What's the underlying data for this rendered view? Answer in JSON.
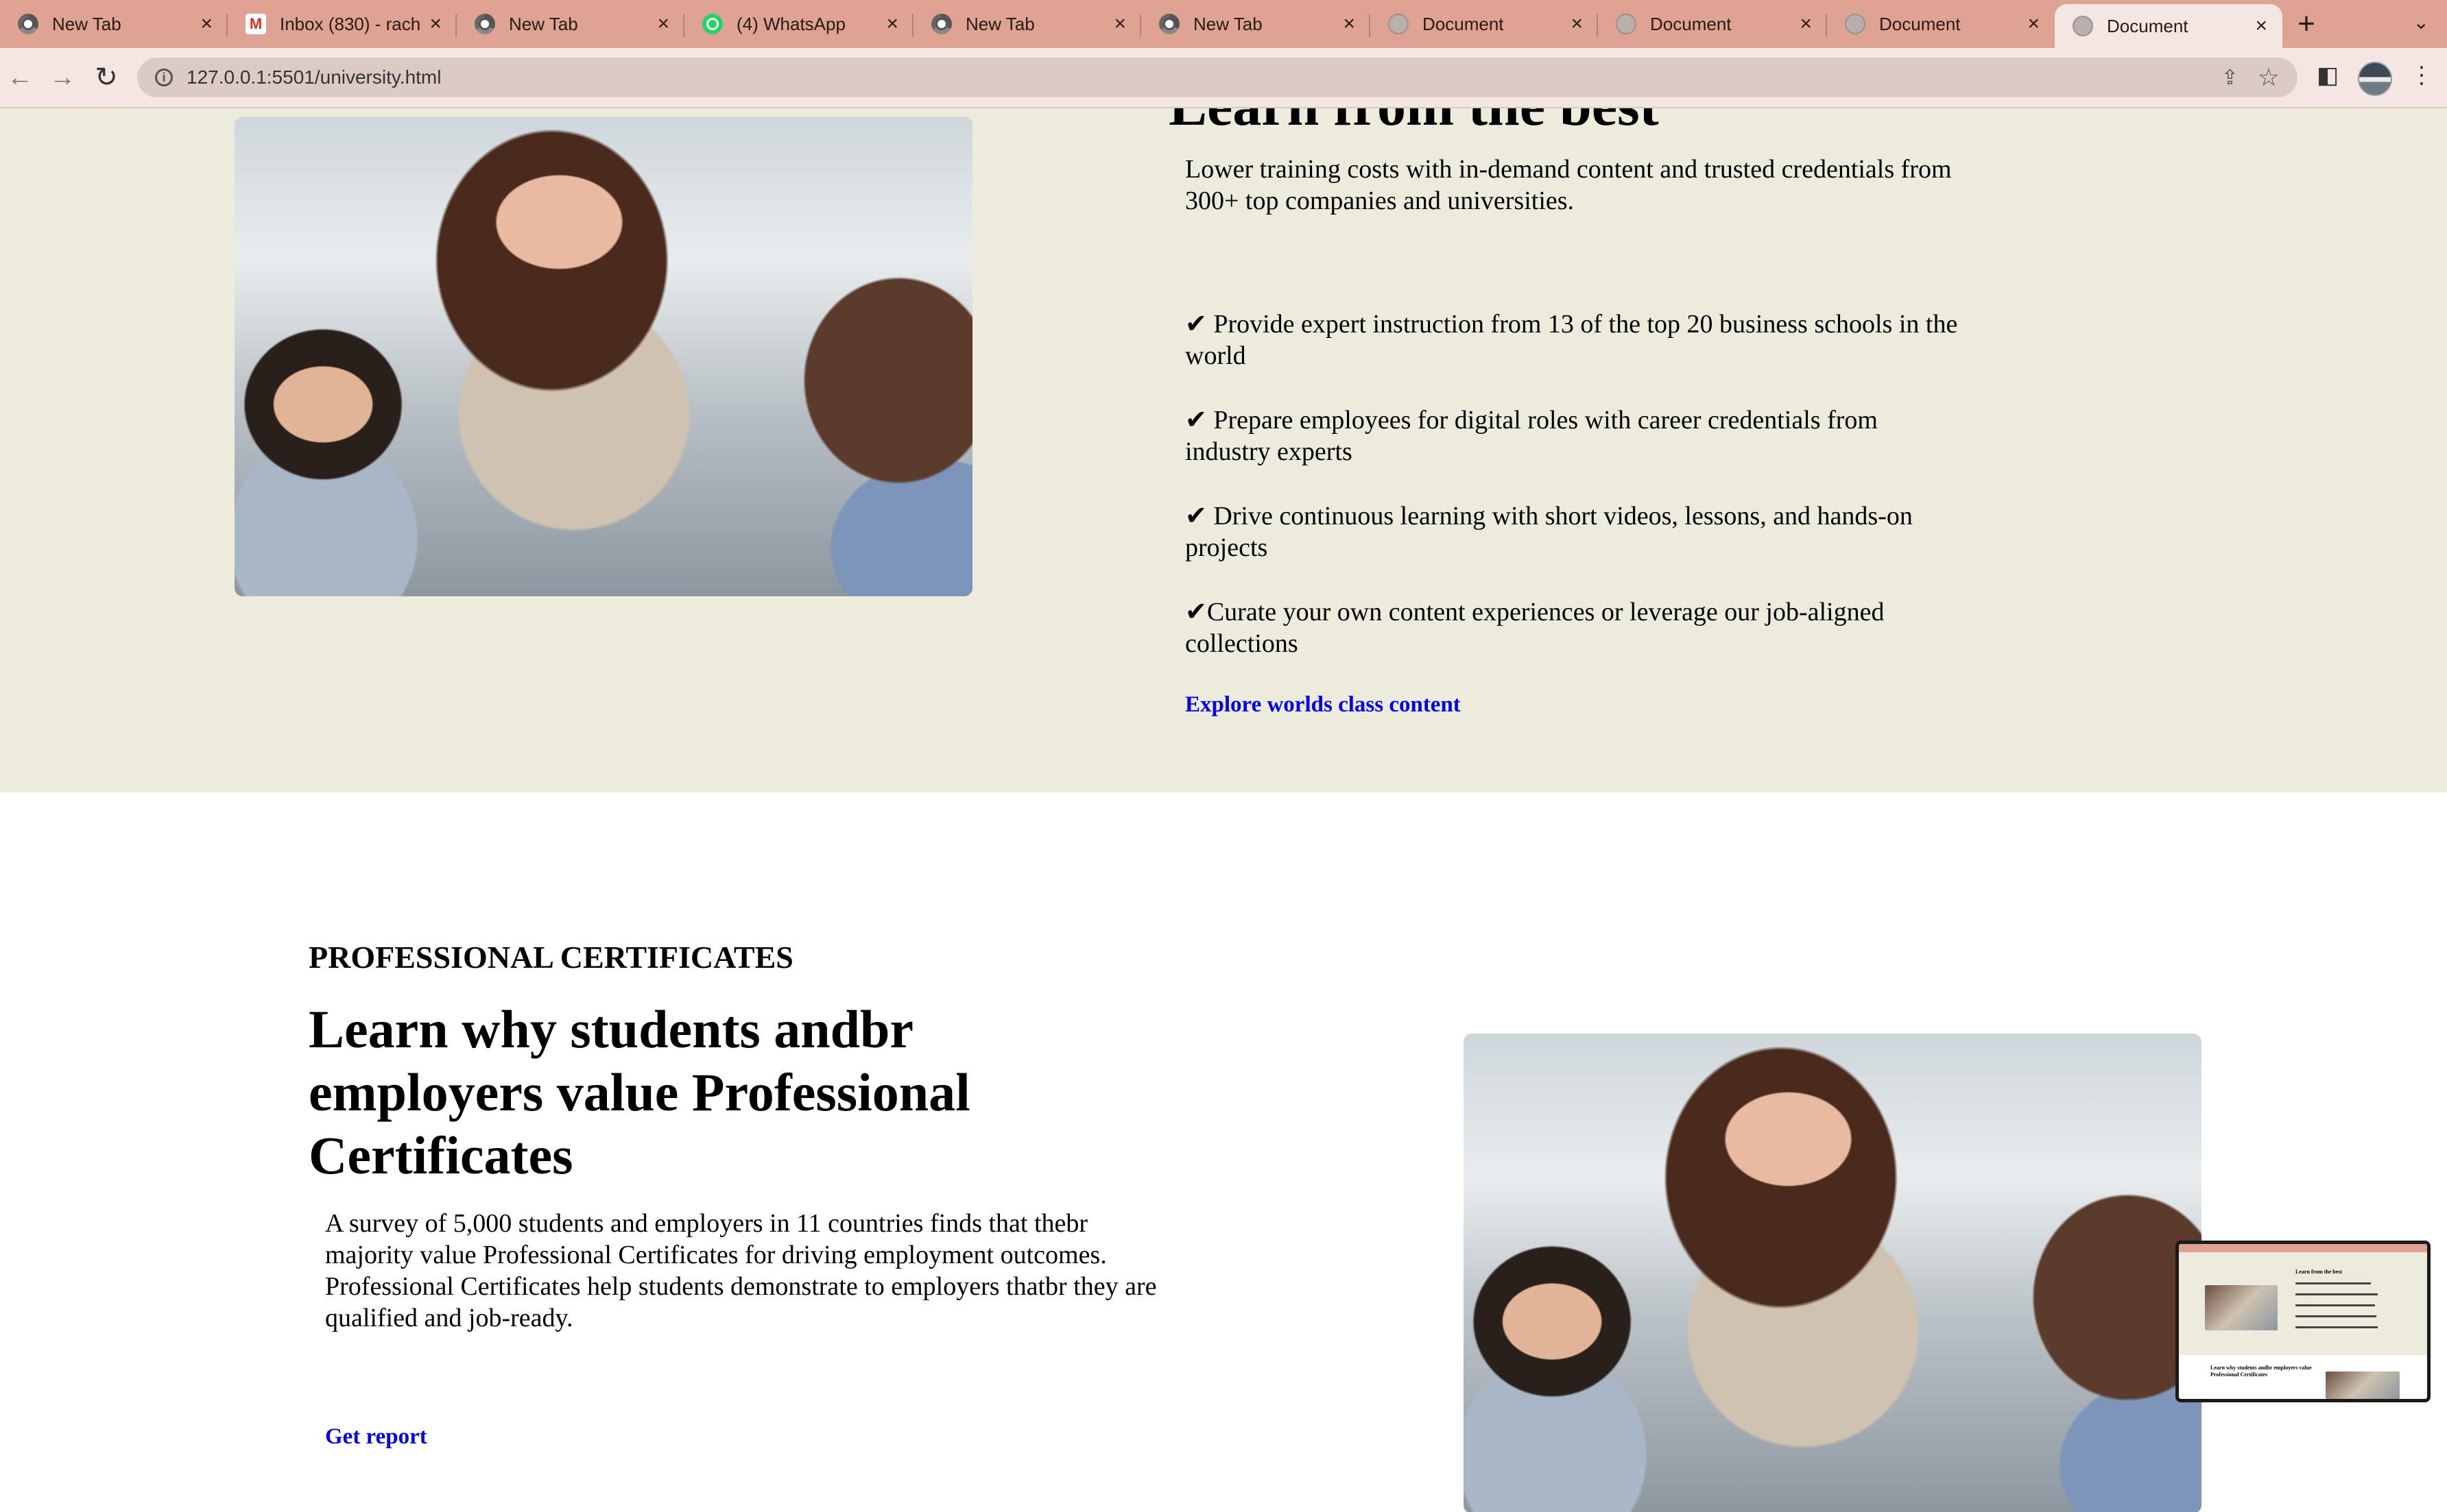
{
  "browser": {
    "tabs": [
      {
        "title": "New Tab",
        "icon": "chrome-icon",
        "active": false
      },
      {
        "title": "Inbox (830) - rach",
        "icon": "gmail-icon",
        "active": false
      },
      {
        "title": "New Tab",
        "icon": "chrome-icon",
        "active": false
      },
      {
        "title": "(4) WhatsApp",
        "icon": "whatsapp-icon",
        "active": false
      },
      {
        "title": "New Tab",
        "icon": "chrome-icon",
        "active": false
      },
      {
        "title": "New Tab",
        "icon": "chrome-icon",
        "active": false
      },
      {
        "title": "Document",
        "icon": "globe-icon",
        "active": false
      },
      {
        "title": "Document",
        "icon": "globe-icon",
        "active": false
      },
      {
        "title": "Document",
        "icon": "globe-icon",
        "active": false
      },
      {
        "title": "Document",
        "icon": "globe-icon",
        "active": true
      }
    ],
    "url": "127.0.0.1:5501/university.html",
    "colors": {
      "tabbar": "#dea393",
      "toolbar": "#f4e7e2"
    }
  },
  "hero": {
    "heading": "Learn from the best",
    "intro": [
      "Lower training costs with in-demand content and trusted credentials from",
      "300+ top companies and universities."
    ],
    "items": [
      "✔ Provide expert instruction from 13 of the top 20 business schools in the world",
      "✔ Prepare employees for digital roles with career credentials from industry experts",
      "✔ Drive continuous learning with short videos, lessons, and hands-on projects",
      "✔Curate your own content experiences or leverage our job-aligned collections"
    ],
    "link": "Explore worlds class content",
    "background": "#ecebdc"
  },
  "certificates": {
    "eyebrow": "PROFESSIONAL CERTIFICATES",
    "heading": "Learn why students andbr employers value Professional Certificates",
    "paragraphs": [
      "A survey of 5,000 students and employers in 11 countries finds that thebr majority value Professional Certificates for driving employment outcomes.",
      "Professional Certificates help students demonstrate to employers thatbr they are qualified and job-ready."
    ],
    "link": "Get report"
  },
  "thumbnail": {
    "title": "Learn from the best",
    "subheading": "Learn why students andbr employers value Professional Certificates"
  }
}
